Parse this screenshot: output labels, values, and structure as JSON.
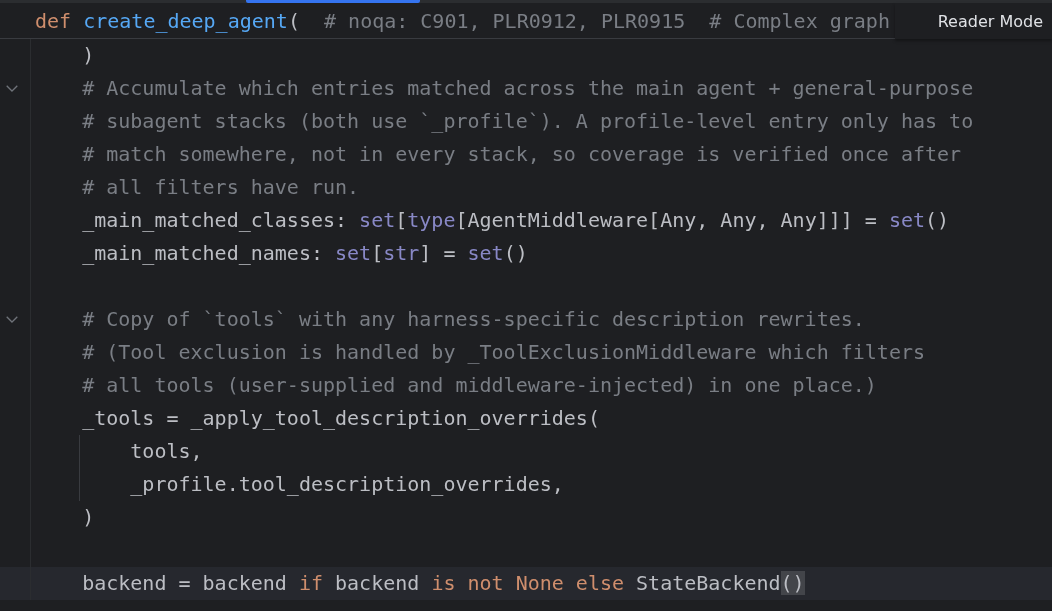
{
  "sticky_header": {
    "tokens": [
      {
        "text": "def ",
        "kind": "keyword"
      },
      {
        "text": "create_deep_agent",
        "kind": "function"
      },
      {
        "text": "(",
        "kind": "plain"
      },
      {
        "text": "  # noqa: C901, PLR0912, PLR0915  # Complex graph",
        "kind": "comment"
      }
    ]
  },
  "reader_mode_button": {
    "label": "Reader Mode"
  },
  "lines": [
    {
      "fold_marker": false,
      "current": false,
      "tokens": [
        {
          "text": "    )",
          "kind": "plain"
        }
      ]
    },
    {
      "fold_marker": true,
      "current": false,
      "tokens": [
        {
          "text": "    # Accumulate which entries matched across the main agent + general-purpose",
          "kind": "comment"
        }
      ]
    },
    {
      "fold_marker": false,
      "current": false,
      "tokens": [
        {
          "text": "    # subagent stacks (both use `_profile`). A profile-level entry only has to",
          "kind": "comment"
        }
      ]
    },
    {
      "fold_marker": false,
      "current": false,
      "tokens": [
        {
          "text": "    # match somewhere, not in every stack, so coverage is verified once after",
          "kind": "comment"
        }
      ]
    },
    {
      "fold_marker": false,
      "current": false,
      "tokens": [
        {
          "text": "    # all filters have run.",
          "kind": "comment"
        }
      ]
    },
    {
      "fold_marker": false,
      "current": false,
      "tokens": [
        {
          "text": "    _main_matched_classes: ",
          "kind": "plain"
        },
        {
          "text": "set",
          "kind": "builtin"
        },
        {
          "text": "[",
          "kind": "plain"
        },
        {
          "text": "type",
          "kind": "builtin"
        },
        {
          "text": "[AgentMiddleware[Any, Any, Any]]] = ",
          "kind": "plain"
        },
        {
          "text": "set",
          "kind": "builtin"
        },
        {
          "text": "()",
          "kind": "plain"
        }
      ]
    },
    {
      "fold_marker": false,
      "current": false,
      "tokens": [
        {
          "text": "    _main_matched_names: ",
          "kind": "plain"
        },
        {
          "text": "set",
          "kind": "builtin"
        },
        {
          "text": "[",
          "kind": "plain"
        },
        {
          "text": "str",
          "kind": "builtin"
        },
        {
          "text": "] = ",
          "kind": "plain"
        },
        {
          "text": "set",
          "kind": "builtin"
        },
        {
          "text": "()",
          "kind": "plain"
        }
      ]
    },
    {
      "fold_marker": false,
      "current": false
    },
    {
      "fold_marker": true,
      "current": false,
      "tokens": [
        {
          "text": "    # Copy of `tools` with any harness-specific description rewrites.",
          "kind": "comment"
        }
      ]
    },
    {
      "fold_marker": false,
      "current": false,
      "tokens": [
        {
          "text": "    # (Tool exclusion is handled by _ToolExclusionMiddleware which filters",
          "kind": "comment"
        }
      ]
    },
    {
      "fold_marker": false,
      "current": false,
      "tokens": [
        {
          "text": "    # all tools (user-supplied and middleware-injected) in one place.)",
          "kind": "comment"
        }
      ]
    },
    {
      "fold_marker": false,
      "current": false,
      "tokens": [
        {
          "text": "    _tools = _apply_tool_description_overrides(",
          "kind": "plain"
        }
      ]
    },
    {
      "fold_marker": false,
      "current": false,
      "tokens": [
        {
          "text": "        tools,",
          "kind": "plain"
        }
      ]
    },
    {
      "fold_marker": false,
      "current": false,
      "tokens": [
        {
          "text": "        _profile.tool_description_overrides,",
          "kind": "plain"
        }
      ]
    },
    {
      "fold_marker": false,
      "current": false,
      "tokens": [
        {
          "text": "    )",
          "kind": "plain"
        }
      ]
    },
    {
      "fold_marker": false,
      "current": false
    },
    {
      "fold_marker": false,
      "current": true,
      "tokens": [
        {
          "text": "    backend = backend ",
          "kind": "plain"
        },
        {
          "text": "if",
          "kind": "keyword"
        },
        {
          "text": " backend ",
          "kind": "plain"
        },
        {
          "text": "is not None else",
          "kind": "keyword"
        },
        {
          "text": " StateBackend",
          "kind": "plain"
        },
        {
          "text": "()",
          "kind": "brace-match"
        }
      ]
    }
  ]
}
